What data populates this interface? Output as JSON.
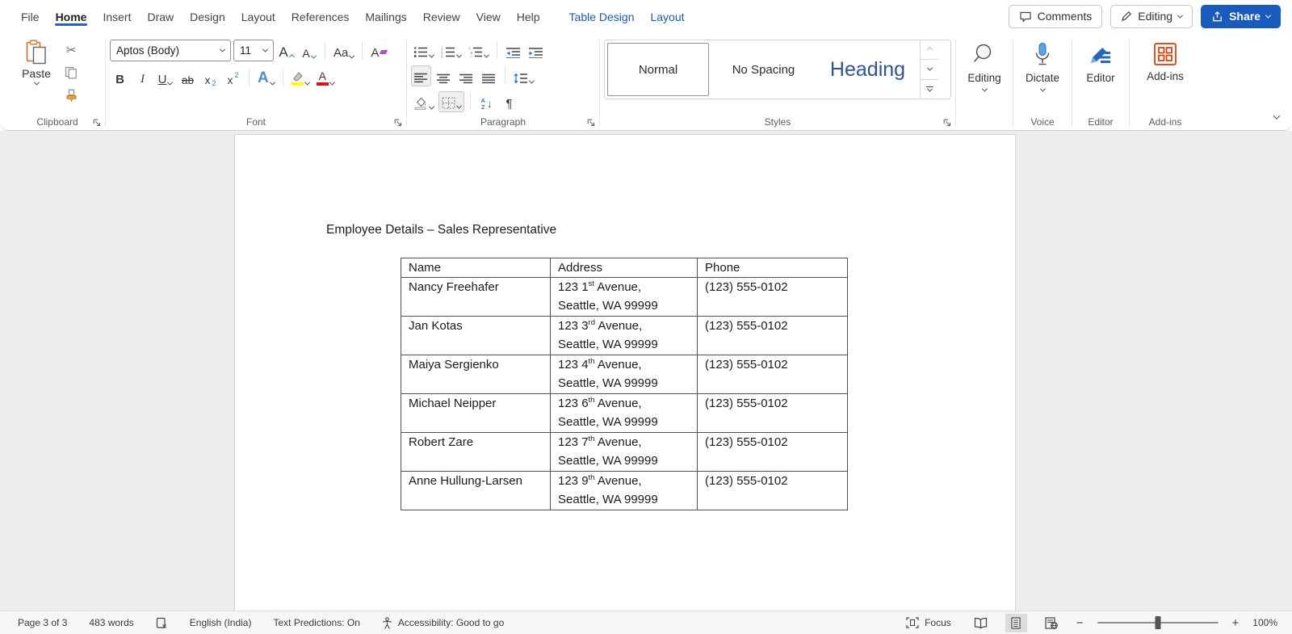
{
  "menu_tabs": {
    "items": [
      {
        "label": "File"
      },
      {
        "label": "Home"
      },
      {
        "label": "Insert"
      },
      {
        "label": "Draw"
      },
      {
        "label": "Design"
      },
      {
        "label": "Layout"
      },
      {
        "label": "References"
      },
      {
        "label": "Mailings"
      },
      {
        "label": "Review"
      },
      {
        "label": "View"
      },
      {
        "label": "Help"
      },
      {
        "label": "Table Design"
      },
      {
        "label": "Layout"
      }
    ]
  },
  "actions": {
    "comments": "Comments",
    "editing": "Editing",
    "share": "Share"
  },
  "ribbon": {
    "clipboard": {
      "paste_label": "Paste",
      "group_label": "Clipboard"
    },
    "font": {
      "font_name": "Aptos (Body)",
      "font_size": "11",
      "group_label": "Font",
      "glyphs": {
        "grow": "A",
        "shrink": "A",
        "change_case": "Aa",
        "clear": "A",
        "bold": "B",
        "italic": "I",
        "underline": "U",
        "strikethrough": "ab",
        "sub_base": "x",
        "sub_small": "2",
        "sup_base": "x",
        "sup_small": "2",
        "effects": "A",
        "font_color": "A"
      }
    },
    "paragraph": {
      "group_label": "Paragraph",
      "glyphs": {
        "sort_a": "A",
        "sort_z": "Z",
        "sort_arrow": "↓",
        "pilcrow": "¶"
      }
    },
    "styles": {
      "group_label": "Styles",
      "items": [
        "Normal",
        "No Spacing",
        "Heading"
      ]
    },
    "editing_button": {
      "label": "Editing"
    },
    "voice": {
      "button_label": "Dictate",
      "group_label": "Voice"
    },
    "editor": {
      "button_label": "Editor",
      "group_label": "Editor"
    },
    "addins": {
      "button_label": "Add-ins",
      "group_label": "Add-ins"
    }
  },
  "document": {
    "title": "Employee Details – Sales Representative",
    "table": {
      "headers": [
        "Name",
        "Address",
        "Phone"
      ],
      "rows": [
        {
          "name": "Nancy Freehafer",
          "addr_pre": "123 1",
          "addr_sup": "st",
          "addr_post": " Avenue,",
          "addr_line2": "Seattle, WA 99999",
          "phone": "(123) 555-0102"
        },
        {
          "name": "Jan Kotas",
          "addr_pre": "123 3",
          "addr_sup": "rd",
          "addr_post": " Avenue,",
          "addr_line2": "Seattle, WA 99999",
          "phone": "(123) 555-0102"
        },
        {
          "name": "Maiya Sergienko",
          "addr_pre": "123 4",
          "addr_sup": "th",
          "addr_post": " Avenue,",
          "addr_line2": "Seattle, WA 99999",
          "phone": "(123) 555-0102"
        },
        {
          "name": "Michael Neipper",
          "addr_pre": "123 6",
          "addr_sup": "th",
          "addr_post": " Avenue,",
          "addr_line2": "Seattle, WA 99999",
          "phone": "(123) 555-0102"
        },
        {
          "name": "Robert Zare",
          "addr_pre": "123 7",
          "addr_sup": "th",
          "addr_post": " Avenue,",
          "addr_line2": "Seattle, WA 99999",
          "phone": "(123) 555-0102"
        },
        {
          "name": "Anne Hullung-Larsen",
          "addr_pre": "123 9",
          "addr_sup": "th",
          "addr_post": " Avenue,",
          "addr_line2": "Seattle, WA 99999",
          "phone": "(123) 555-0102"
        }
      ]
    }
  },
  "status_bar": {
    "page_info": "Page 3 of 3",
    "word_count": "483 words",
    "language": "English (India)",
    "predictions": "Text Predictions: On",
    "accessibility": "Accessibility: Good to go",
    "focus_label": "Focus",
    "zoom_out": "−",
    "zoom_in": "+",
    "zoom_level": "100%"
  },
  "colors": {
    "accent_blue": "#185ABD",
    "tab_underline": "#2363C5",
    "heading_style_blue": "#2F5496",
    "icon_blue": "#2B7CD3",
    "mic_blue": "#5BA3E8",
    "addins_orange": "#D83B01",
    "clipboard_orange": "#D4802C",
    "highlight_yellow": "#FFFF00",
    "font_color_red": "#E01010",
    "canvas_gray": "#EDEDED",
    "statusbar_gray": "#F6F6F6"
  }
}
